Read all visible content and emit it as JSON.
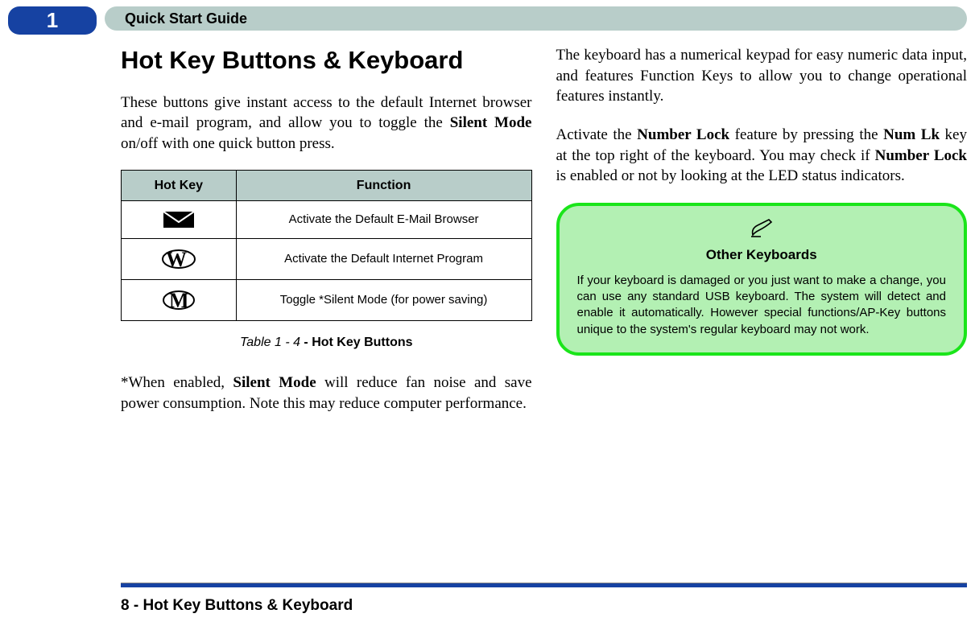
{
  "chapter_number": "1",
  "header_title": "Quick Start Guide",
  "left": {
    "heading": "Hot Key Buttons & Keyboard",
    "intro_part1": "These buttons give instant access to the default Internet browser and e-mail program, and allow you to toggle the ",
    "intro_bold": "Silent Mode",
    "intro_part2": " on/off with one quick button press.",
    "table": {
      "headers": {
        "col1": "Hot Key",
        "col2": "Function"
      },
      "rows": [
        {
          "icon": "mail",
          "func": "Activate the Default E-Mail Browser"
        },
        {
          "icon": "browser",
          "func": "Activate the Default Internet Program"
        },
        {
          "icon": "silent",
          "func": "Toggle *Silent Mode (for power saving)"
        }
      ],
      "caption_italic": "Table 1 - 4",
      "caption_bold": " - Hot Key Buttons"
    },
    "note_part1": "*When enabled, ",
    "note_bold": "Silent Mode",
    "note_part2": " will reduce fan noise and save power consumption. Note this may reduce computer performance."
  },
  "right": {
    "para1": "The keyboard has a numerical keypad for easy numeric data input, and features Function Keys to allow you to change operational features instantly.",
    "para2_a": "Activate the ",
    "para2_b": "Number Lock",
    "para2_c": " feature by pressing the ",
    "para2_d": "Num Lk",
    "para2_e": " key at the top right of the keyboard. You may check if ",
    "para2_f": "Number Lock",
    "para2_g": " is enabled or not by looking at the LED status indicators.",
    "callout": {
      "title": "Other Keyboards",
      "body": "If your keyboard is damaged or you just want to make a change, you can use any standard USB keyboard. The system will detect and enable it automatically. However special functions/AP-Key buttons unique to the system's regular keyboard may not work."
    }
  },
  "footer": "8 - Hot Key Buttons & Keyboard"
}
